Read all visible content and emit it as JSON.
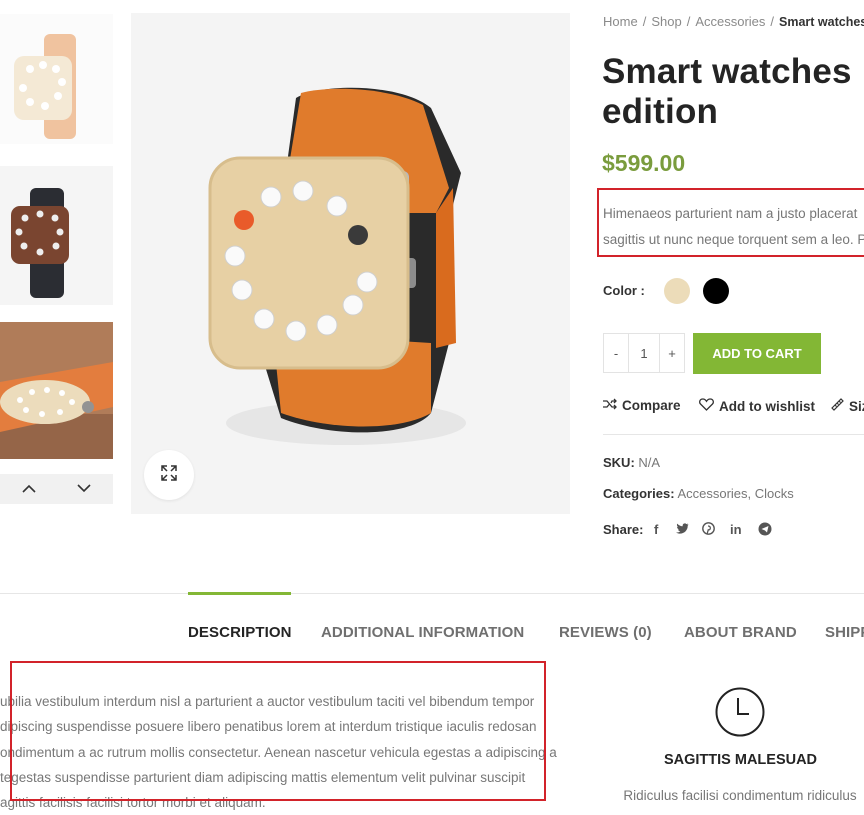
{
  "breadcrumb": {
    "items": [
      "Home",
      "Shop",
      "Accessories"
    ],
    "current": "Smart watches"
  },
  "product": {
    "title_line1": "Smart watches",
    "title_line2": "edition",
    "price": "$599.00",
    "short_description": [
      "Himenaeos parturient nam a justo placerat",
      "sagittis ut nunc neque torquent sem a leo. P"
    ],
    "color_label": "Color :",
    "colors": [
      "#ecdcb9",
      "#000000"
    ],
    "quantity": {
      "minus": "-",
      "value": "1",
      "plus": "+"
    },
    "add_to_cart": "ADD TO CART"
  },
  "actions": {
    "compare": "Compare",
    "wishlist": "Add to wishlist",
    "size_guide": "Siz"
  },
  "meta": {
    "sku_label": "SKU:",
    "sku_value": "N/A",
    "categories_label": "Categories:",
    "categories": [
      "Accessories",
      "Clocks"
    ],
    "share_label": "Share:"
  },
  "share_icons": [
    "facebook-icon",
    "twitter-icon",
    "pinterest-icon",
    "linkedin-icon",
    "telegram-icon"
  ],
  "tabs": [
    {
      "label": "DESCRIPTION"
    },
    {
      "label": "ADDITIONAL INFORMATION"
    },
    {
      "label": "REVIEWS (0)"
    },
    {
      "label": "ABOUT BRAND"
    },
    {
      "label": "SHIPP"
    }
  ],
  "description": [
    "ubilia vestibulum interdum nisl a parturient a auctor vestibulum taciti vel bibendum tempor",
    "dipiscing suspendisse posuere libero penatibus lorem at interdum tristique iaculis redosan",
    "ondimentum a ac rutrum mollis consectetur. Aenean nascetur vehicula egestas a adipiscing a",
    "tegestas suspendisse parturient diam adipiscing mattis elementum velit pulvinar suscipit",
    "agittis facilisis facilisi tortor morbi et aliquam."
  ],
  "feature": {
    "icon": "clock-icon",
    "title": "SAGITTIS MALESUAD",
    "text": "Ridiculus facilisi condimentum ridiculus"
  },
  "colors": {
    "accent": "#83b735",
    "price": "#7a9c3d",
    "highlight": "#d2232a",
    "watch_strap": "#e07b2c",
    "watch_face": "#e7d0a4"
  }
}
